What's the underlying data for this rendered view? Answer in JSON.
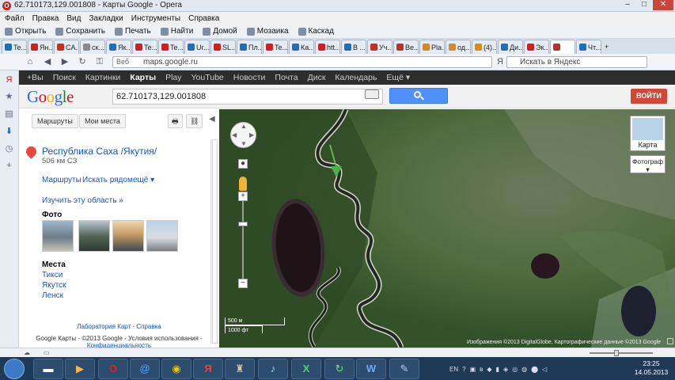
{
  "window": {
    "title": "62.710173,129.001808 - Карты Google - Opera",
    "controls": [
      "–",
      "□",
      "✕"
    ]
  },
  "menu": [
    "Файл",
    "Правка",
    "Вид",
    "Закладки",
    "Инструменты",
    "Справка"
  ],
  "bookmarks": [
    "Открыть",
    "Сохранить",
    "Печать",
    "Найти",
    "Домой",
    "Мозаика",
    "Каскад"
  ],
  "tabs": [
    "Te...",
    "Ян...",
    "CA...",
    "ск...",
    "Як...",
    "Te...",
    "Te...",
    "Ur...",
    "SL...",
    "Пл...",
    "Te...",
    "Ка...",
    "htt...",
    "В ...",
    "Уч...",
    "Be...",
    "Pla...",
    "од...",
    "(4)...",
    "Ди...",
    "Эк...",
    "",
    "Чт..."
  ],
  "address": {
    "prefix": "Веб",
    "url": "maps.google.ru",
    "search_placeholder": "Искать в Яндекс"
  },
  "gbar": [
    "+Вы",
    "Поиск",
    "Картинки",
    "Карты",
    "Play",
    "YouTube",
    "Новости",
    "Почта",
    "Диск",
    "Календарь",
    "Ещё ▾"
  ],
  "gbar_current": "Карты",
  "google": {
    "logo": "Google",
    "query": "62.710173,129.001808",
    "signin": "ВОЙТИ"
  },
  "panel": {
    "routes_btn": "Маршруты",
    "myplaces_btn": "Мои места",
    "place_title": "Республика Саха /Якутия/",
    "place_sub": "506 км СЗ",
    "actions": [
      "Маршруты",
      "Искать рядом",
      "ещё ▾"
    ],
    "explore": "Изучить эту область »",
    "photo_head": "Фото",
    "places_head": "Места",
    "places": [
      "Тикси",
      "Якутск",
      "Ленск"
    ],
    "footer_links": "Лаборатория Карт - Справка",
    "footer_copy": "Google Карты - ©2013 Google - Условия использования -",
    "footer_more": "Конфиденциальность"
  },
  "map": {
    "type_map": "Карта",
    "type_photo": "Фотограф ▾",
    "scale_m": "500 м",
    "scale_ft": "1000 фт",
    "copyright": "Изображения ©2013 DigitalGlobe, Картографические данные ©2013 Google"
  },
  "taskbar": {
    "lang": "EN",
    "time": "23:25",
    "date": "14.05.2013"
  }
}
